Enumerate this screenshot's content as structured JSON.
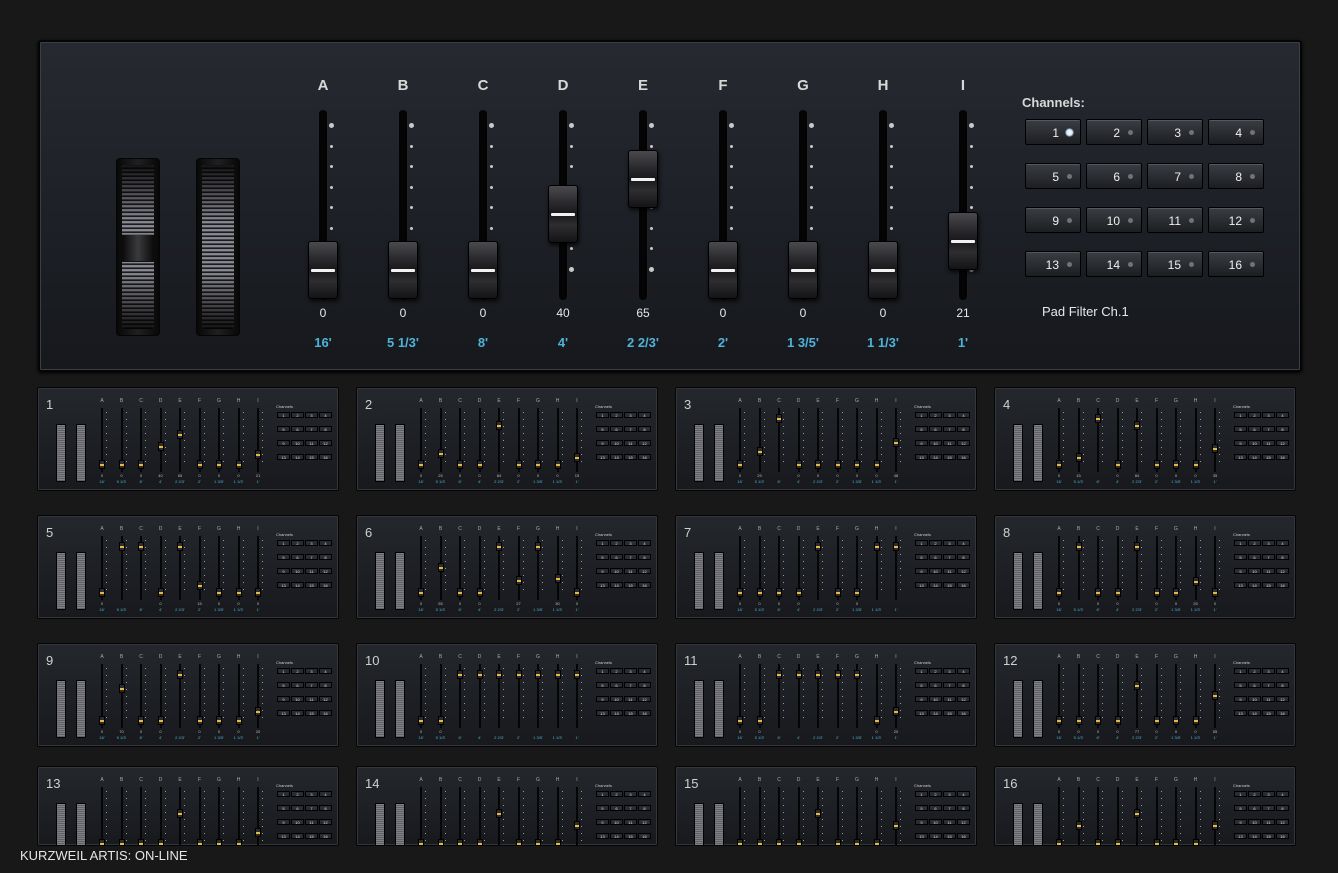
{
  "main": {
    "columns": [
      {
        "letter": "A",
        "value": "0",
        "footage": "16'",
        "level": 0
      },
      {
        "letter": "B",
        "value": "0",
        "footage": "5 1/3'",
        "level": 0
      },
      {
        "letter": "C",
        "value": "0",
        "footage": "8'",
        "level": 0
      },
      {
        "letter": "D",
        "value": "40",
        "footage": "4'",
        "level": 40
      },
      {
        "letter": "E",
        "value": "65",
        "footage": "2 2/3'",
        "level": 65
      },
      {
        "letter": "F",
        "value": "0",
        "footage": "2'",
        "level": 0
      },
      {
        "letter": "G",
        "value": "0",
        "footage": "1 3/5'",
        "level": 0
      },
      {
        "letter": "H",
        "value": "0",
        "footage": "1 1/3'",
        "level": 0
      },
      {
        "letter": "I",
        "value": "21",
        "footage": "1'",
        "level": 21
      }
    ],
    "channels_title": "Channels:",
    "channels": [
      "1",
      "2",
      "3",
      "4",
      "5",
      "6",
      "7",
      "8",
      "9",
      "10",
      "11",
      "12",
      "13",
      "14",
      "15",
      "16"
    ],
    "selected_channel": "1",
    "pad_filter": "Pad Filter Ch.1"
  },
  "minis": [
    {
      "num": "1",
      "levels": [
        0,
        0,
        0,
        40,
        65,
        0,
        0,
        0,
        21
      ]
    },
    {
      "num": "2",
      "levels": [
        0,
        25,
        0,
        0,
        84,
        0,
        0,
        0,
        15
      ]
    },
    {
      "num": "3",
      "levels": [
        0,
        29,
        100,
        0,
        0,
        0,
        0,
        0,
        48
      ]
    },
    {
      "num": "4",
      "levels": [
        0,
        15,
        100,
        0,
        84,
        0,
        0,
        0,
        35
      ]
    },
    {
      "num": "5",
      "levels": [
        0,
        100,
        100,
        0,
        100,
        15,
        0,
        0,
        0
      ]
    },
    {
      "num": "6",
      "levels": [
        0,
        55,
        0,
        0,
        100,
        27,
        100,
        30,
        0
      ]
    },
    {
      "num": "7",
      "levels": [
        0,
        0,
        0,
        0,
        100,
        0,
        0,
        100,
        100
      ]
    },
    {
      "num": "8",
      "levels": [
        0,
        100,
        0,
        0,
        100,
        0,
        0,
        25,
        0
      ]
    },
    {
      "num": "9",
      "levels": [
        0,
        70,
        0,
        0,
        100,
        0,
        0,
        0,
        20
      ]
    },
    {
      "num": "10",
      "levels": [
        0,
        0,
        100,
        100,
        100,
        100,
        100,
        100,
        100
      ]
    },
    {
      "num": "11",
      "levels": [
        0,
        0,
        100,
        100,
        100,
        100,
        100,
        0,
        20
      ]
    },
    {
      "num": "12",
      "levels": [
        0,
        0,
        0,
        0,
        77,
        0,
        0,
        0,
        55
      ]
    },
    {
      "num": "13",
      "levels": [
        0,
        0,
        0,
        0,
        65,
        0,
        0,
        0,
        25
      ]
    },
    {
      "num": "14",
      "levels": [
        0,
        0,
        0,
        0,
        65,
        0,
        0,
        0,
        40
      ]
    },
    {
      "num": "15",
      "levels": [
        0,
        0,
        0,
        0,
        65,
        0,
        0,
        0,
        40
      ]
    },
    {
      "num": "16",
      "levels": [
        0,
        40,
        0,
        0,
        65,
        0,
        0,
        0,
        40
      ]
    }
  ],
  "status": "KURZWEIL ARTIS: ON-LINE",
  "colors": {
    "accent": "#4fb3d9",
    "fader_line": "#f2f2f2",
    "mini_fader_line": "#e6b840"
  }
}
